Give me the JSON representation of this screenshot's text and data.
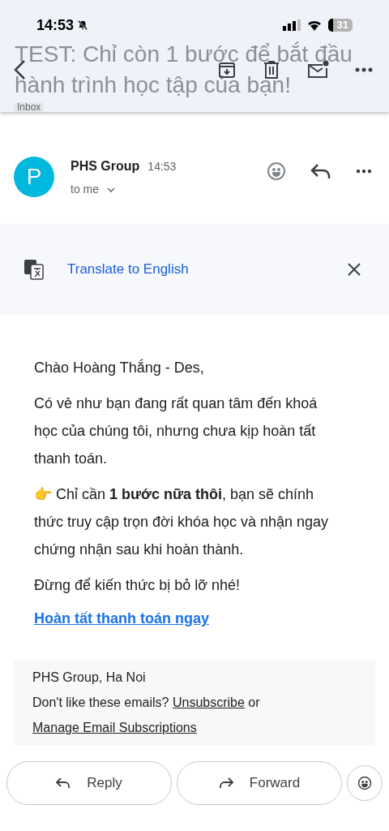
{
  "status_bar": {
    "time": "14:53",
    "battery": "31",
    "silent": true
  },
  "header": {
    "subject_lines": [
      "TEST: Chỉ còn 1 bước để bắt đầu",
      "hành trình học tập của bạn!"
    ],
    "label": "Inbox"
  },
  "sender": {
    "avatar_letter": "P",
    "name": "PHS Group",
    "time": "14:53",
    "recipient": "to me"
  },
  "translate": {
    "label": "Translate to English"
  },
  "body": {
    "greeting": "Chào Hoàng Thắng - Des,",
    "paragraphs": [
      {
        "kind": "text",
        "text": "Có vẻ như bạn đang rất quan tâm đến khoá học của chúng tôi, nhưng chưa kịp hoàn tất thanh toán."
      },
      {
        "kind": "text",
        "text": "👉 Chỉ cần **1 bước nữa thôi**, bạn sẽ chính thức truy cập trọn đời khóa học và nhận ngay chứng nhận sau khi hoàn thành."
      },
      {
        "kind": "text",
        "text": "Đừng để kiến thức bị bỏ lỡ nhé!"
      },
      {
        "kind": "link",
        "text": "Hoàn tất thanh toán ngay"
      }
    ]
  },
  "footer": {
    "address": "PHS Group, Ha Noi",
    "prompt": "Don't like these emails?",
    "unsubscribe": "Unsubscribe",
    "joiner": "or",
    "manage": "Manage Email Subscriptions"
  },
  "actions": [
    {
      "kind": "reply",
      "label": "Reply"
    },
    {
      "kind": "forward",
      "label": "Forward"
    }
  ]
}
